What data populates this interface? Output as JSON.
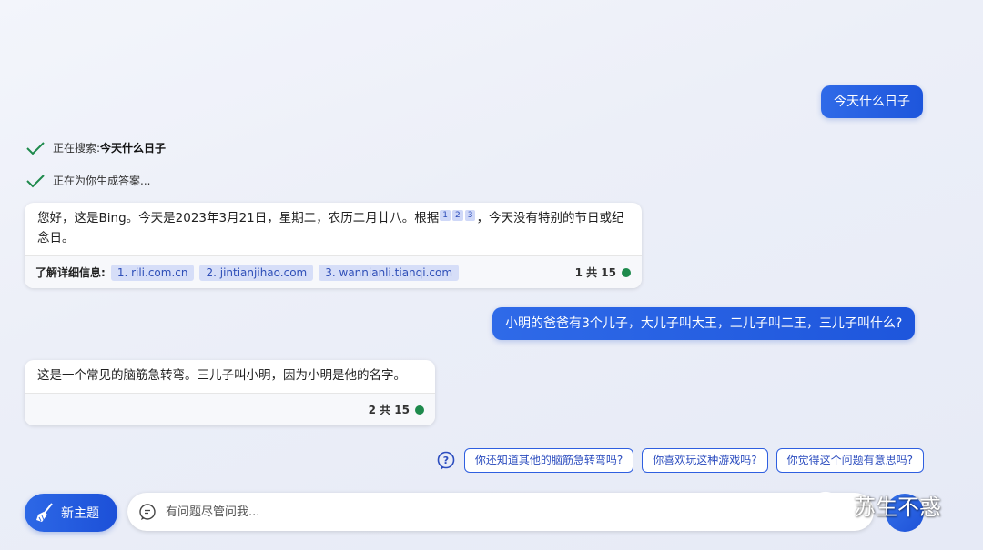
{
  "conversation": {
    "user_message_1": "今天什么日子",
    "status": {
      "searching_prefix": "正在搜索: ",
      "searching_query": "今天什么日子",
      "generating": "正在为你生成答案..."
    },
    "bot_reply_1": {
      "text_before_cites": "您好，这是Bing。今天是2023年3月21日，星期二，农历二月廿八。根据",
      "citations": [
        "1",
        "2",
        "3"
      ],
      "text_after_cites": "，今天没有特别的节日或纪念日。",
      "footer_label": "了解详细信息:",
      "sources": [
        "1. rili.com.cn",
        "2. jintianjihao.com",
        "3. wannianli.tianqi.com"
      ],
      "counter": "1 共 15"
    },
    "user_message_2": "小明的爸爸有3个儿子，大儿子叫大王，二儿子叫二王，三儿子叫什么?",
    "bot_reply_2": {
      "text": "这是一个常见的脑筋急转弯。三儿子叫小明，因为小明是他的名字。",
      "counter": "2 共 15"
    }
  },
  "suggestions": [
    "你还知道其他的脑筋急转弯吗?",
    "你喜欢玩这种游戏吗?",
    "你觉得这个问题有意思吗?"
  ],
  "composer": {
    "new_topic_label": "新主题",
    "placeholder": "有问题尽管问我..."
  },
  "watermark": {
    "text": "苏生不惑"
  },
  "colors": {
    "accent": "#1e56dc",
    "status_check": "#1e8a4c",
    "citation_bg": "#d6def8"
  },
  "icons": [
    "check-icon",
    "help-icon",
    "broom-icon",
    "chat-icon",
    "wechat-icon"
  ]
}
